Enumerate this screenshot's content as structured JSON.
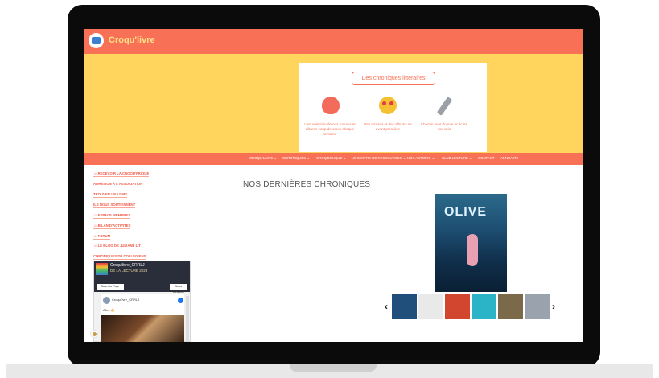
{
  "site": {
    "title": "Croqu'livre",
    "brand_color": "#f87055",
    "hero_color": "#ffd55e"
  },
  "hero": {
    "title": "Des chroniques littéraires",
    "features": [
      {
        "icon": "heart-icon",
        "text": "Une sélection de nos romans et albums coup de coeur chaque semaine"
      },
      {
        "icon": "heart-eyes-emoji-icon",
        "text": "Des romans et des albums en avant-première"
      },
      {
        "icon": "pencil-icon",
        "text": "Chacun peut donner et écrire son avis"
      }
    ]
  },
  "nav": {
    "items": [
      "CROQU'LIVRE ⌄",
      "CHRONIQUES ⌄",
      "CROQ'BOUQUE ⌄",
      "LE CENTRE DE RESSOURCES ⌄",
      "NOS ACTIONS ⌄",
      "CLUB LECTURE ⌄",
      "CONTACT",
      "ANNUAIRE"
    ]
  },
  "sidebar": {
    "links": [
      "☺ RECEVOIR LA CROQU'FRIQUE",
      "ADHÉSION À L'ASSOCIATION",
      "TROUVER UN LIVRE",
      "ILS NOUS SOUTIENNENT",
      "☺ ESPACE MEMBRES",
      "☺ BILAN D'ACTIVITÉS",
      "☺ FORUM",
      "☺ LE BLOG DE JULIANE LIT",
      "CHRONIQUES DE COLLÉGIENS"
    ]
  },
  "facebook": {
    "page_name": "Croqu'livre_CRRLJ",
    "cover_text": "DE LA LECTURE 2023",
    "follow_label": "Suivre la Page",
    "contact_label": "Nous contacter",
    "post_author": "Croqu'livre_CRRLJ",
    "post_text": "Allez 🔥"
  },
  "main": {
    "section_title": "NOS DERNIÈRES CHRONIQUES",
    "featured_book_title": "OLIVE",
    "carousel": {
      "prev_arrow": "‹",
      "next_arrow": "›",
      "thumb_colors": [
        "#1f4f7a",
        "#e9e9e9",
        "#d2452e",
        "#2bb3c8",
        "#7a6a4a",
        "#9aa3ad"
      ]
    }
  }
}
